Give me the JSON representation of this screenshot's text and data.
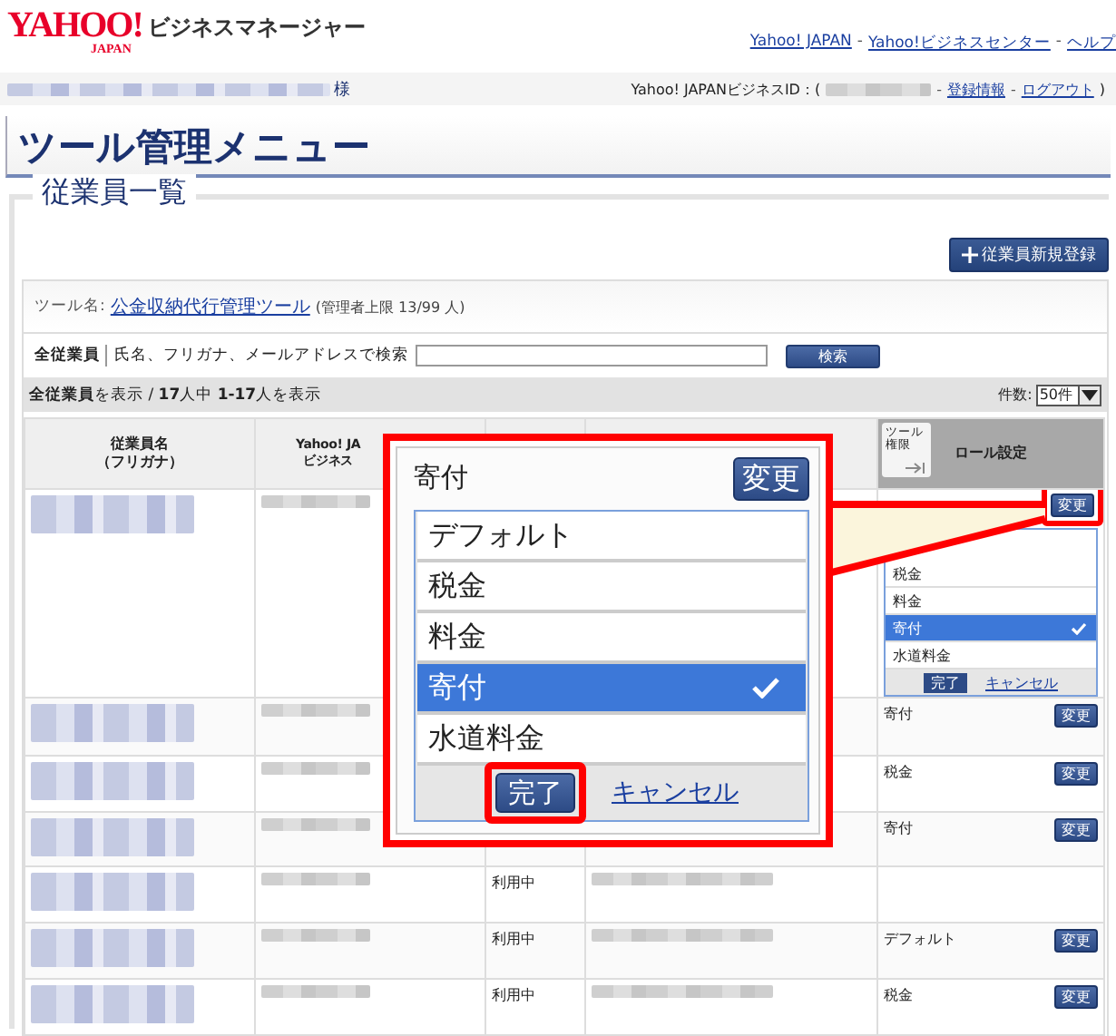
{
  "header": {
    "logo": "YAHOO!",
    "logo_sub": "JAPAN",
    "product": "ビジネスマネージャー",
    "separator": "-",
    "links": [
      "Yahoo! JAPAN",
      "Yahoo!ビジネスセンター",
      "ヘルプ"
    ]
  },
  "user_bar": {
    "honorific": "様",
    "id_label": "Yahoo! JAPANビジネスID：(",
    "separator": "-",
    "links": [
      "登録情報",
      "ログアウト"
    ],
    "closing": ")"
  },
  "page_title": "ツール管理メニュー",
  "section": {
    "title": "従業員一覧",
    "add_button": "従業員新規登録",
    "tool": {
      "label": "ツール名:",
      "name": "公金収納代行管理ツール",
      "limit": "(管理者上限 13/99 人)"
    },
    "search": {
      "scope": "全従業員",
      "hint": "氏名、フリガナ、メールアドレスで検索",
      "button": "検索"
    },
    "summary": "**全従業員**を表示 / **17**人中 **1-17**人を表示",
    "per_page": {
      "label": "件数:",
      "value": "50件"
    },
    "table": {
      "columns": [
        {
          "lines": [
            "従業員名",
            "（フリガナ）"
          ]
        },
        {
          "lines": [
            "Yahoo! JA",
            "ビジネス"
          ]
        },
        {},
        {},
        {
          "tab": "ツール権限",
          "lines": [
            "ロール設定"
          ]
        }
      ],
      "rows": [
        {
          "kind": "editor",
          "button": "変更",
          "highlighted": true,
          "options": [
            {
              "label": "税金",
              "selected": false
            },
            {
              "label": "料金",
              "selected": false
            },
            {
              "label": "寄付",
              "selected": true
            },
            {
              "label": "水道料金",
              "selected": false
            }
          ],
          "done": "完了",
          "cancel": "キャンセル"
        },
        {
          "kind": "assigned",
          "role": "寄付",
          "button": "変更"
        },
        {
          "kind": "assigned",
          "role": "税金",
          "button": "変更"
        },
        {
          "kind": "assigned",
          "role": "寄付",
          "button": "変更"
        },
        {
          "kind": "unassigned",
          "status": "利用中"
        },
        {
          "kind": "assigned",
          "status": "利用中",
          "role": "デフォルト",
          "button": "変更"
        },
        {
          "kind": "assigned",
          "status": "利用中",
          "role": "税金",
          "button": "変更"
        }
      ]
    }
  },
  "callout": {
    "current": "寄付",
    "button": "変更",
    "options": [
      {
        "label": "デフォルト",
        "selected": false
      },
      {
        "label": "税金",
        "selected": false
      },
      {
        "label": "料金",
        "selected": false
      },
      {
        "label": "寄付",
        "selected": true
      },
      {
        "label": "水道料金",
        "selected": false
      }
    ],
    "done": "完了",
    "done_highlighted": true,
    "cancel": "キャンセル"
  }
}
